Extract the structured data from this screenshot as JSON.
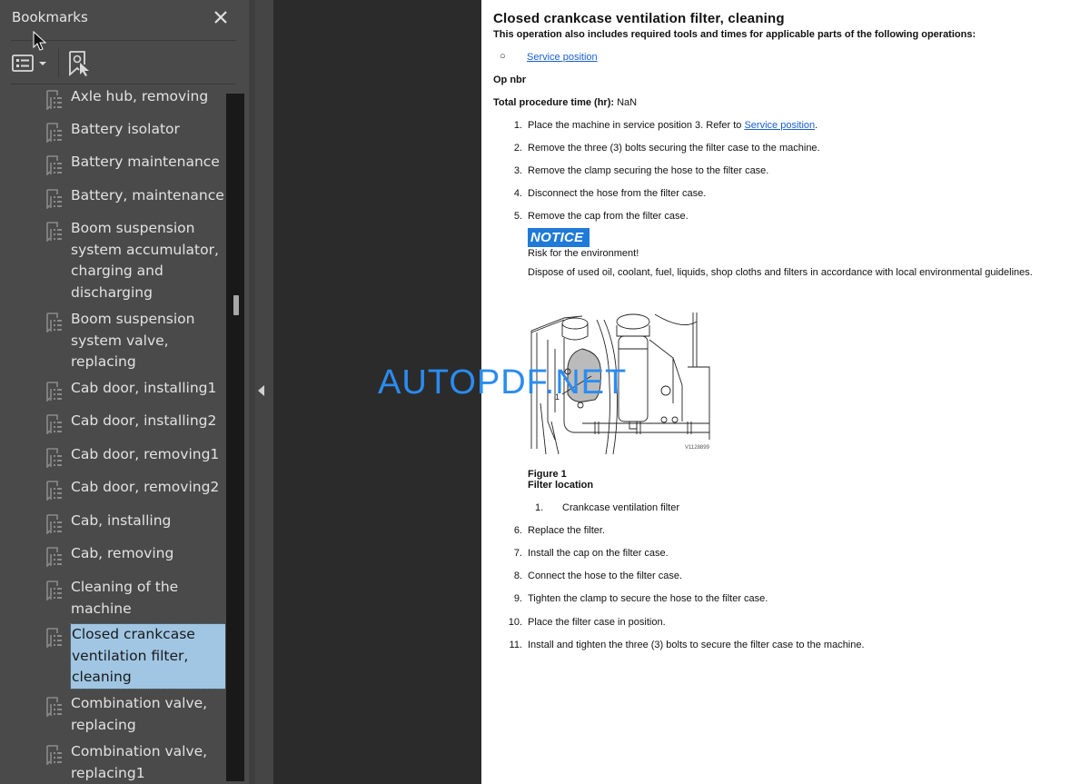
{
  "bookmarks_panel": {
    "title": "Bookmarks",
    "close_icon": "close-icon",
    "options_icon": "bookmark-options-icon",
    "add_bookmark_icon": "add-bookmark-icon",
    "items": [
      {
        "label": "Axle hub, removing",
        "selected": false
      },
      {
        "label": "Battery isolator",
        "selected": false
      },
      {
        "label": "Battery maintenance",
        "selected": false
      },
      {
        "label": "Battery, maintenance",
        "selected": false
      },
      {
        "label": "Boom suspension system accumulator, charging and discharging",
        "selected": false
      },
      {
        "label": "Boom suspension system valve, replacing",
        "selected": false
      },
      {
        "label": "Cab door, installing1",
        "selected": false
      },
      {
        "label": "Cab door, installing2",
        "selected": false
      },
      {
        "label": "Cab door, removing1",
        "selected": false
      },
      {
        "label": "Cab door, removing2",
        "selected": false
      },
      {
        "label": "Cab, installing",
        "selected": false
      },
      {
        "label": "Cab, removing",
        "selected": false
      },
      {
        "label": "Cleaning of the machine",
        "selected": false
      },
      {
        "label": "Closed crankcase ventilation filter, cleaning",
        "selected": true
      },
      {
        "label": "Combination valve, replacing",
        "selected": false
      },
      {
        "label": "Combination valve, replacing1",
        "selected": false
      }
    ]
  },
  "document": {
    "title": "Closed crankcase ventilation filter, cleaning",
    "subtitle": "This operation also includes required tools and times for applicable parts of the following operations:",
    "related_bullet": "○",
    "related_link": "Service position",
    "op_nbr_label": "Op nbr",
    "total_time_label": "Total procedure time (hr):",
    "total_time_value": "NaN",
    "steps_before": [
      {
        "num": "1.",
        "text": "Place the machine in service position 3. Refer to ",
        "link": "Service position",
        "after": "."
      },
      {
        "num": "2.",
        "text": "Remove the three (3) bolts securing the filter case to the machine."
      },
      {
        "num": "3.",
        "text": "Remove the clamp securing the hose to the filter case."
      },
      {
        "num": "4.",
        "text": "Disconnect the hose from the filter case."
      },
      {
        "num": "5.",
        "text": "Remove the cap from the filter case."
      }
    ],
    "notice": {
      "badge": "NOTICE",
      "risk": "Risk for the environment!",
      "text": "Dispose of used oil, coolant, fuel, liquids, shop cloths and filters in accordance with local environmental guidelines.",
      "color": "#1f7ad8"
    },
    "figure": {
      "code": "V1128899",
      "callout": "1",
      "number": "Figure 1",
      "caption": "Filter location",
      "legend": [
        {
          "num": "1.",
          "text": "Crankcase ventilation filter"
        }
      ]
    },
    "steps_after": [
      {
        "num": "6.",
        "text": "Replace the filter."
      },
      {
        "num": "7.",
        "text": "Install the cap on the filter case."
      },
      {
        "num": "8.",
        "text": "Connect the hose to the filter case."
      },
      {
        "num": "9.",
        "text": "Tighten the clamp to secure the hose to the filter case."
      },
      {
        "num": "10.",
        "text": "Place the filter case in position."
      },
      {
        "num": "11.",
        "text": "Install and tighten the three (3) bolts to secure the filter case to the machine."
      }
    ]
  },
  "watermark": "AUTOPDF.NET",
  "colors": {
    "panel_bg": "#4a4a4a",
    "selection_bg": "#a0c6e3",
    "link": "#1a5fd0",
    "watermark": "#2a8cf0"
  }
}
